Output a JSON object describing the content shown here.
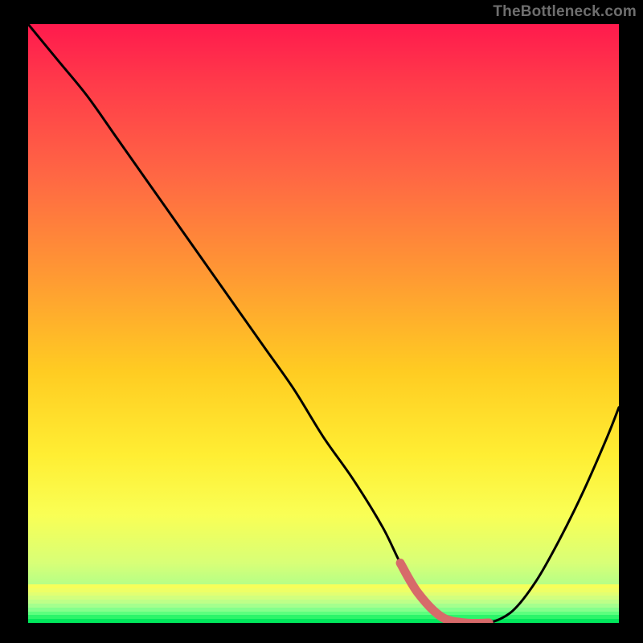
{
  "watermark": "TheBottleneck.com",
  "colors": {
    "curve_stroke": "#000000",
    "highlight_stroke": "#d76a6a",
    "gradient_top": "#ff1a4d",
    "gradient_bottom": "#00e85c",
    "frame_bg": "#000000"
  },
  "chart_data": {
    "type": "line",
    "title": "",
    "xlabel": "",
    "ylabel": "",
    "xlim": [
      0,
      100
    ],
    "ylim": [
      0,
      100
    ],
    "grid": false,
    "legend": false,
    "series": [
      {
        "name": "bottleneck-curve",
        "x": [
          0,
          5,
          10,
          15,
          20,
          25,
          30,
          35,
          40,
          45,
          50,
          55,
          60,
          63,
          66,
          70,
          74,
          78,
          82,
          86,
          90,
          94,
          98,
          100
        ],
        "values": [
          100,
          94,
          88,
          81,
          74,
          67,
          60,
          53,
          46,
          39,
          31,
          24,
          16,
          10,
          5,
          1,
          0,
          0,
          2,
          7,
          14,
          22,
          31,
          36
        ]
      }
    ],
    "highlight_range_x": [
      63,
      78
    ]
  }
}
